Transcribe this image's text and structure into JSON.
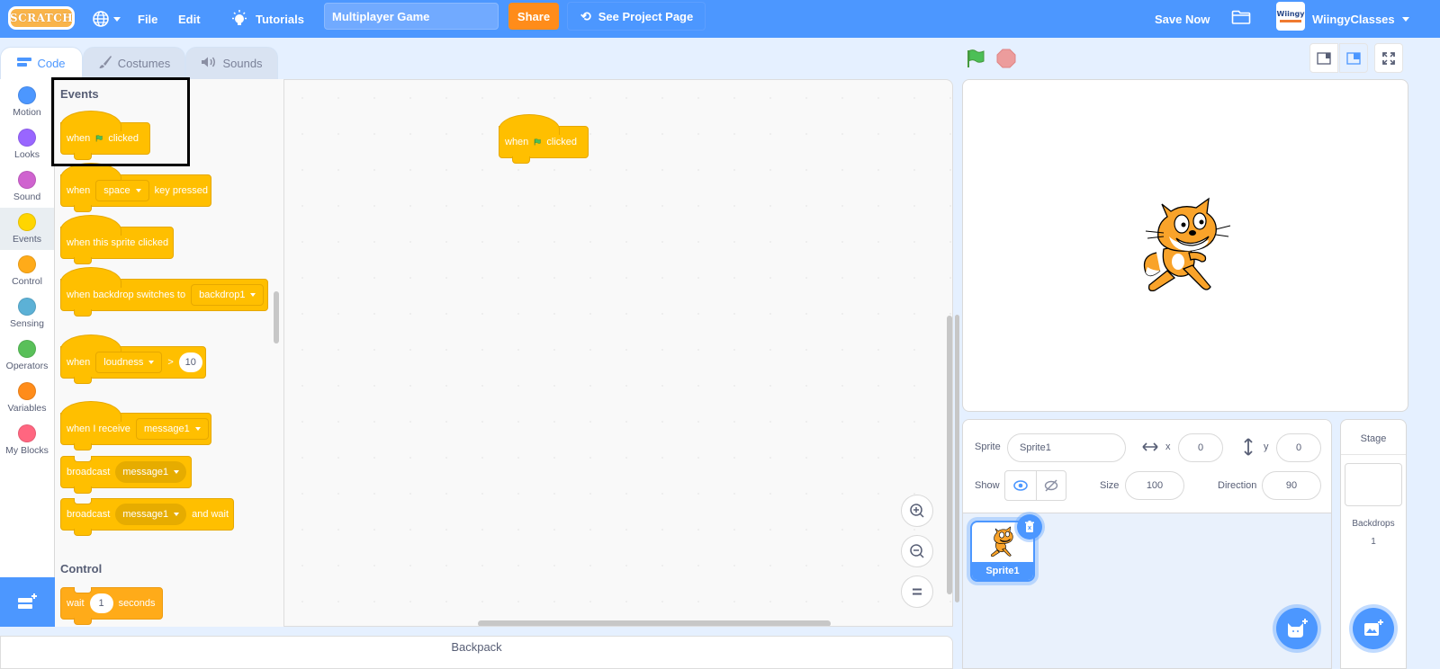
{
  "menubar": {
    "logo_text": "SCRATCH",
    "language_icon": "globe-icon",
    "file_label": "File",
    "edit_label": "Edit",
    "tutorials_label": "Tutorials",
    "project_title": "Multiplayer Game",
    "share_label": "Share",
    "see_project_label": "See Project Page",
    "save_now_label": "Save Now",
    "avatar_text": "Wiingy",
    "username": "WiingyClasses"
  },
  "tabs": [
    {
      "label": "Code",
      "icon": "code-icon",
      "active": true
    },
    {
      "label": "Costumes",
      "icon": "brush-icon",
      "active": false
    },
    {
      "label": "Sounds",
      "icon": "speaker-icon",
      "active": false
    }
  ],
  "categories": [
    {
      "label": "Motion",
      "color": "#4c97ff"
    },
    {
      "label": "Looks",
      "color": "#9966ff"
    },
    {
      "label": "Sound",
      "color": "#cf63cf"
    },
    {
      "label": "Events",
      "color": "#ffd500",
      "selected": true
    },
    {
      "label": "Control",
      "color": "#ffab19"
    },
    {
      "label": "Sensing",
      "color": "#5cb1d6"
    },
    {
      "label": "Operators",
      "color": "#59c059"
    },
    {
      "label": "Variables",
      "color": "#ff8c1a"
    },
    {
      "label": "My Blocks",
      "color": "#ff6680"
    }
  ],
  "palette": {
    "events_title": "Events",
    "control_title": "Control",
    "blocks": {
      "flag_clicked": {
        "pre": "when",
        "post": "clicked"
      },
      "key_pressed": {
        "pre": "when",
        "dropdown": "space",
        "post": "key pressed"
      },
      "sprite_clicked": {
        "text": "when this sprite clicked"
      },
      "backdrop_switch": {
        "pre": "when backdrop switches to",
        "dropdown": "backdrop1"
      },
      "loudness": {
        "pre": "when",
        "dropdown": "loudness",
        "op": ">",
        "value": "10"
      },
      "receive": {
        "pre": "when I receive",
        "dropdown": "message1"
      },
      "broadcast": {
        "pre": "broadcast",
        "dropdown": "message1"
      },
      "broadcast_wait": {
        "pre": "broadcast",
        "dropdown": "message1",
        "post": "and wait"
      },
      "wait": {
        "pre": "wait",
        "value": "1",
        "post": "seconds"
      }
    }
  },
  "script_area": {
    "script_block": {
      "pre": "when",
      "post": "clicked"
    }
  },
  "backpack": {
    "label": "Backpack"
  },
  "sprite_info": {
    "sprite_label": "Sprite",
    "sprite_name": "Sprite1",
    "x_label": "x",
    "x_value": "0",
    "y_label": "y",
    "y_value": "0",
    "show_label": "Show",
    "size_label": "Size",
    "size_value": "100",
    "direction_label": "Direction",
    "direction_value": "90"
  },
  "sprites": [
    {
      "name": "Sprite1",
      "selected": true
    }
  ],
  "stage_pane": {
    "title": "Stage",
    "backdrops_label": "Backdrops",
    "backdrops_count": "1"
  }
}
